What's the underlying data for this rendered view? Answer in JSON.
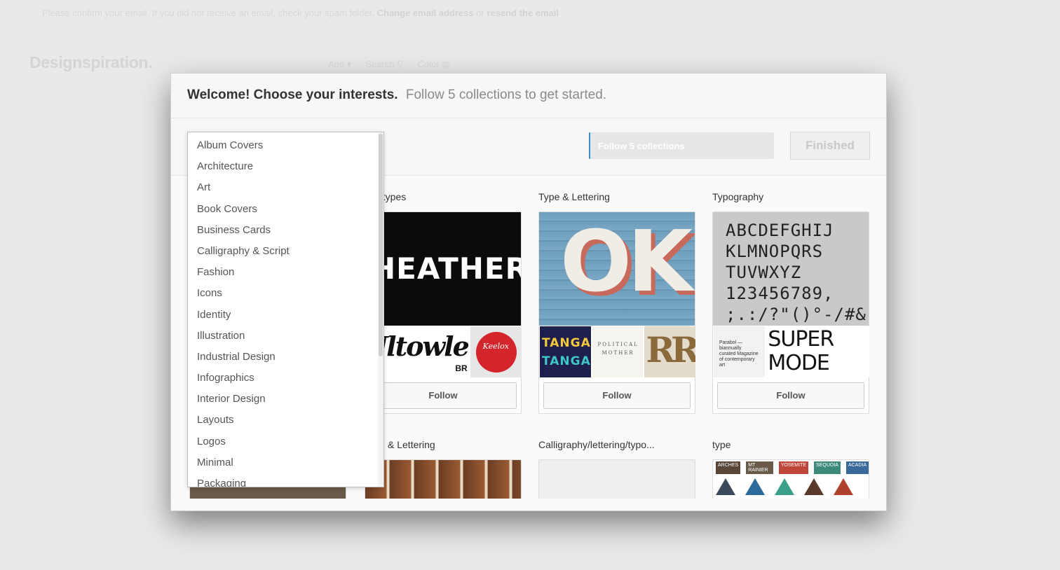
{
  "background": {
    "notice_text": "Please confirm your email. If you did not receive an email, check your spam folder.",
    "notice_link1": "Change email address",
    "notice_or": "or",
    "notice_link2": "resend the email",
    "logo": "Designspiration.",
    "nav": [
      "Add ▾",
      "Search ⚲",
      "Color ◍"
    ]
  },
  "modal": {
    "title": "Welcome! Choose your interests.",
    "subtitle": "Follow 5 collections to get started.",
    "progress_label": "Follow 5 collections",
    "progress_fraction": 0,
    "finished_label": "Finished"
  },
  "dropdown": {
    "items": [
      "Album Covers",
      "Architecture",
      "Art",
      "Book Covers",
      "Business Cards",
      "Calligraphy & Script",
      "Fashion",
      "Icons",
      "Identity",
      "Illustration",
      "Industrial Design",
      "Infographics",
      "Interior Design",
      "Layouts",
      "Logos",
      "Minimal",
      "Packaging"
    ]
  },
  "collections": [
    {
      "title": "otypes",
      "hero_text": "HEATHER",
      "thumb1_text": "Ultowle",
      "thumb1_sub": "BR",
      "thumb2_text": "Keelox",
      "follow_label": "Follow"
    },
    {
      "title": "Type & Lettering",
      "hero_text": "OK",
      "thumb1_text": "TANGA",
      "thumb2_text": "POLITICAL MOTHER",
      "thumb3_text": "RR",
      "follow_label": "Follow"
    },
    {
      "title": "Typography",
      "hero_lines": [
        "ABCDEFGHIJ",
        "KLMNOPQRS",
        "TUVWXYZ",
        "123456789,",
        ";.:/?\"()°-/#&"
      ],
      "thumb1_text": "Parabol — biannually curated Magazine of contemporary art",
      "thumb2_text": "SUPER MODE",
      "follow_label": "Follow"
    }
  ],
  "collections_row2": [
    {
      "title": "& Lettering"
    },
    {
      "title": "Calligraphy/lettering/typo..."
    },
    {
      "title": "type",
      "badges": [
        "ARCHES",
        "MT RAINIER",
        "YOSEMITE",
        "SEQUOIA",
        "ACADIA"
      ]
    }
  ]
}
